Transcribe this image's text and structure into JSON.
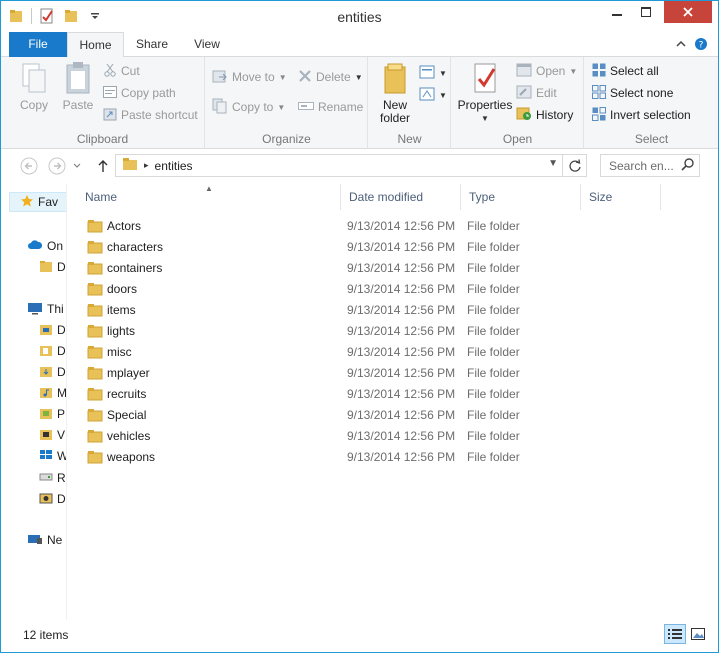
{
  "window": {
    "title": "entities"
  },
  "ribbon_tabs": {
    "file": "File",
    "home": "Home",
    "share": "Share",
    "view": "View"
  },
  "clipboard": {
    "label": "Clipboard",
    "copy": "Copy",
    "paste": "Paste",
    "cut": "Cut",
    "copy_path": "Copy path",
    "paste_shortcut": "Paste shortcut"
  },
  "organize": {
    "label": "Organize",
    "move_to": "Move to",
    "copy_to": "Copy to",
    "delete": "Delete",
    "rename": "Rename"
  },
  "new_group": {
    "label": "New",
    "new_folder_line1": "New",
    "new_folder_line2": "folder"
  },
  "open_group": {
    "label": "Open",
    "properties": "Properties",
    "open": "Open",
    "edit": "Edit",
    "history": "History"
  },
  "select_group": {
    "label": "Select",
    "select_all": "Select all",
    "select_none": "Select none",
    "invert_selection": "Invert selection"
  },
  "address": {
    "path": "entities",
    "search_placeholder": "Search en..."
  },
  "navpane": {
    "favorites": "Fav",
    "onedrive": "On",
    "onedrive_child": "D",
    "thispc": "Thi",
    "pc_children": [
      "D",
      "D",
      "D",
      "M",
      "P",
      "V",
      "W",
      "R",
      "D"
    ],
    "network": "Ne"
  },
  "columns": {
    "name": "Name",
    "date": "Date modified",
    "type": "Type",
    "size": "Size"
  },
  "files": [
    {
      "name": "Actors",
      "date": "9/13/2014 12:56 PM",
      "type": "File folder"
    },
    {
      "name": "characters",
      "date": "9/13/2014 12:56 PM",
      "type": "File folder"
    },
    {
      "name": "containers",
      "date": "9/13/2014 12:56 PM",
      "type": "File folder"
    },
    {
      "name": "doors",
      "date": "9/13/2014 12:56 PM",
      "type": "File folder"
    },
    {
      "name": "items",
      "date": "9/13/2014 12:56 PM",
      "type": "File folder"
    },
    {
      "name": "lights",
      "date": "9/13/2014 12:56 PM",
      "type": "File folder"
    },
    {
      "name": "misc",
      "date": "9/13/2014 12:56 PM",
      "type": "File folder"
    },
    {
      "name": "mplayer",
      "date": "9/13/2014 12:56 PM",
      "type": "File folder"
    },
    {
      "name": "recruits",
      "date": "9/13/2014 12:56 PM",
      "type": "File folder"
    },
    {
      "name": "Special",
      "date": "9/13/2014 12:56 PM",
      "type": "File folder"
    },
    {
      "name": "vehicles",
      "date": "9/13/2014 12:56 PM",
      "type": "File folder"
    },
    {
      "name": "weapons",
      "date": "9/13/2014 12:56 PM",
      "type": "File folder"
    }
  ],
  "status": {
    "item_count": "12 items"
  },
  "colors": {
    "accent": "#1979ca",
    "close": "#c7443b",
    "folder": "#e8c158",
    "border": "#1e9bd6"
  }
}
